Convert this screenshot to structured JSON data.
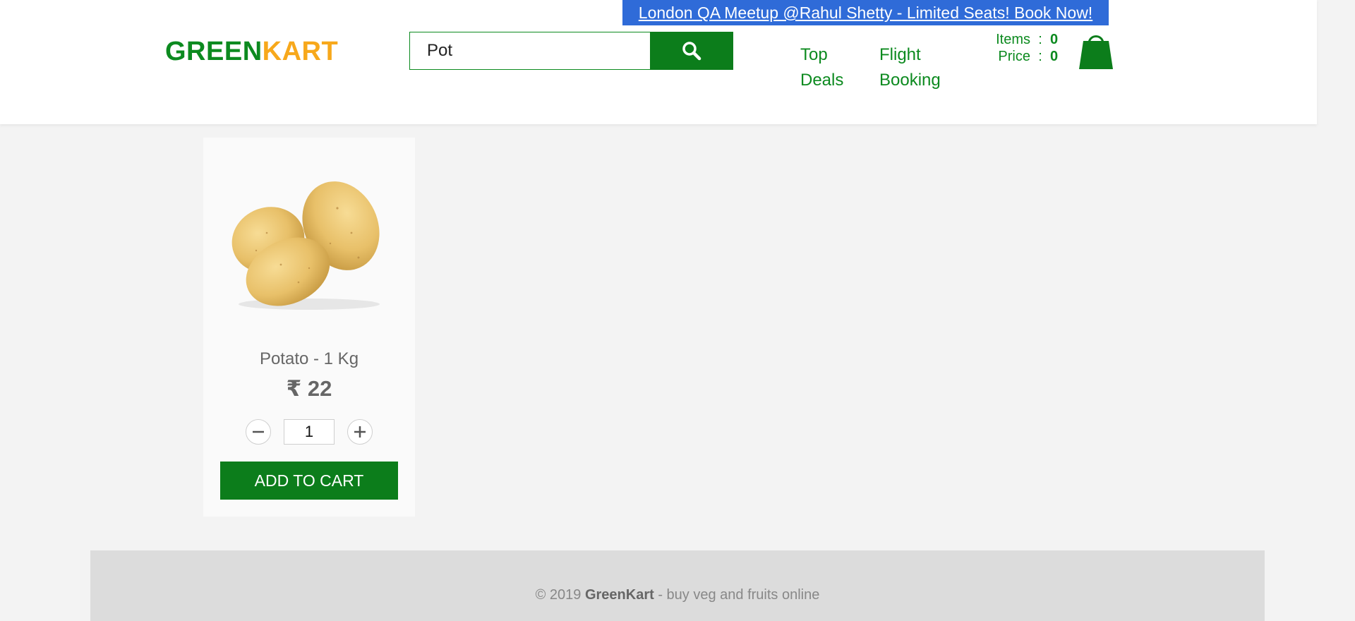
{
  "promo": {
    "text": "London QA Meetup @Rahul Shetty - Limited Seats! Book Now!"
  },
  "logo": {
    "part1": "GREEN",
    "part2": "KART"
  },
  "search": {
    "value": "Pot"
  },
  "nav": {
    "top_deals": "Top Deals",
    "flight_booking": "Flight Booking"
  },
  "cart": {
    "items_label": "Items",
    "items_value": "0",
    "price_label": "Price",
    "price_value": "0",
    "separator": ":"
  },
  "product": {
    "name": "Potato - 1 Kg",
    "price": "₹ 22",
    "quantity": "1",
    "add_label": "ADD TO CART"
  },
  "footer": {
    "copyright": "© 2019",
    "brand": "GreenKart",
    "tagline": "- buy veg and fruits online"
  },
  "colors": {
    "brand_green": "#0c7d1b",
    "brand_orange": "#f7a81b",
    "promo_blue": "#2f6bd8"
  },
  "icons": {
    "search": "search-icon",
    "cart": "shopping-bag-icon",
    "minus": "minus-icon",
    "plus": "plus-icon",
    "product": "potato-image"
  }
}
